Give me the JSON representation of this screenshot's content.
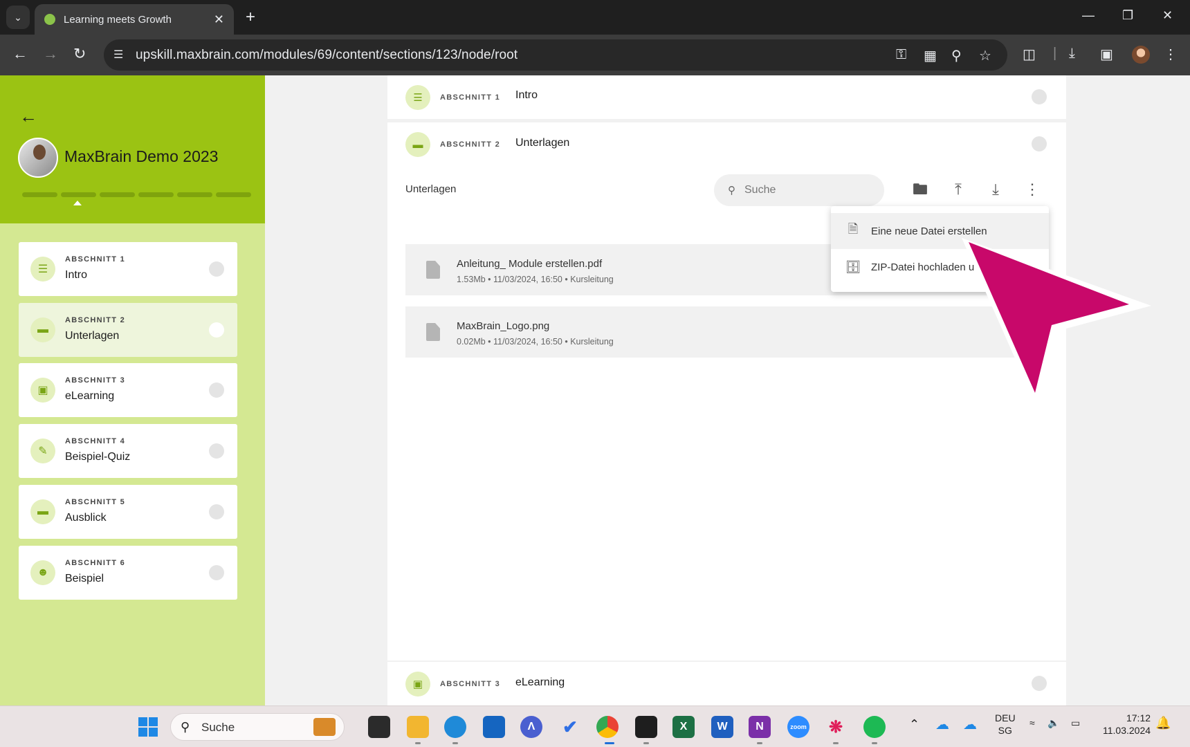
{
  "browser": {
    "tab_title": "Learning meets Growth",
    "url": "upskill.maxbrain.com/modules/69/content/sections/123/node/root"
  },
  "sidebar": {
    "course_title": "MaxBrain Demo 2023",
    "progress_segments": 6,
    "sections": [
      {
        "kicker": "ABSCHNITT 1",
        "name": "Intro",
        "icon": "text-lines-icon"
      },
      {
        "kicker": "ABSCHNITT 2",
        "name": "Unterlagen",
        "icon": "folder-icon"
      },
      {
        "kicker": "ABSCHNITT 3",
        "name": "eLearning",
        "icon": "monitor-book-icon"
      },
      {
        "kicker": "ABSCHNITT 4",
        "name": "Beispiel-Quiz",
        "icon": "quiz-icon"
      },
      {
        "kicker": "ABSCHNITT 5",
        "name": "Ausblick",
        "icon": "folder-icon"
      },
      {
        "kicker": "ABSCHNITT 6",
        "name": "Beispiel",
        "icon": "person-check-icon"
      }
    ]
  },
  "main": {
    "section1": {
      "kicker": "ABSCHNITT 1",
      "name": "Intro"
    },
    "section2": {
      "kicker": "ABSCHNITT 2",
      "name": "Unterlagen"
    },
    "section3": {
      "kicker": "ABSCHNITT 3",
      "name": "eLearning"
    },
    "folder_title": "Unterlagen",
    "search_placeholder": "Suche",
    "files": [
      {
        "name": "Anleitung_ Module erstellen.pdf",
        "meta": "1.53Mb  •  11/03/2024, 16:50  •  Kursleitung"
      },
      {
        "name": "MaxBrain_Logo.png",
        "meta": "0.02Mb  •  11/03/2024, 16:50  •  Kursleitung"
      }
    ],
    "menu": {
      "item1": "Eine neue Datei erstellen",
      "item2": "ZIP-Datei hochladen u"
    }
  },
  "taskbar": {
    "search_label": "Suche",
    "lang": "DEU",
    "region": "SG",
    "time": "17:12",
    "date": "11.03.2024"
  },
  "colors": {
    "brand_green": "#9bc313",
    "sidebar_light": "#d4e892",
    "cursor_pink": "#c8086a"
  }
}
